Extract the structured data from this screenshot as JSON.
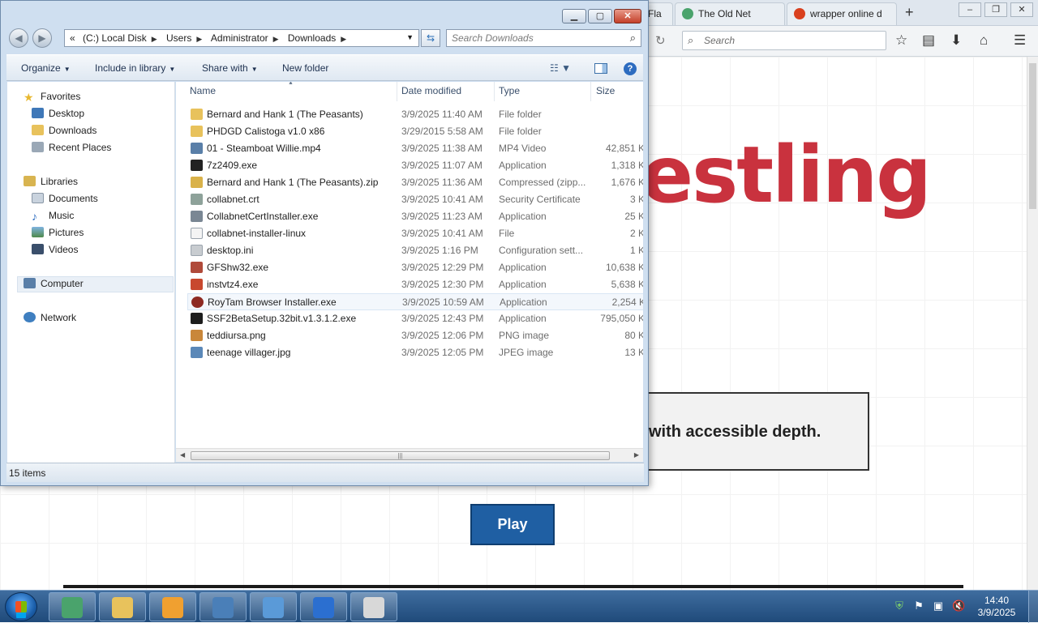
{
  "browser": {
    "tabs": [
      {
        "label": "Fla",
        "icon_color": "#9aa6b2"
      },
      {
        "label": "The Old Net",
        "icon_color": "#4aa36c"
      },
      {
        "label": "wrapper online d",
        "icon_color": "#d9401e"
      }
    ],
    "new_tab_label": "+",
    "search_placeholder": "Search",
    "page_heading_fragment": "estling",
    "info_text_fragment": "with accessible depth.",
    "play_label": "Play",
    "heading_color": "#c9323e"
  },
  "explorer": {
    "address": {
      "chevron": "«",
      "crumbs": [
        "(C:) Local Disk",
        "Users",
        "Administrator",
        "Downloads"
      ]
    },
    "search_placeholder": "Search Downloads",
    "toolbar": {
      "organize": "Organize",
      "include_in_library": "Include in library",
      "share_with": "Share with",
      "new_folder": "New folder"
    },
    "nav": {
      "favorites": "Favorites",
      "desktop": "Desktop",
      "downloads": "Downloads",
      "recent_places": "Recent Places",
      "libraries": "Libraries",
      "documents": "Documents",
      "music": "Music",
      "pictures": "Pictures",
      "videos": "Videos",
      "computer": "Computer",
      "network": "Network"
    },
    "columns": {
      "name": "Name",
      "date": "Date modified",
      "type": "Type",
      "size": "Size"
    },
    "files": [
      {
        "name": "Bernard and Hank 1 (The Peasants)",
        "date": "3/9/2025 11:40 AM",
        "type": "File folder",
        "size": "",
        "icon": "folder-icon",
        "color": "#e8c25c"
      },
      {
        "name": "PHDGD Calistoga v1.0 x86",
        "date": "3/29/2015 5:58 AM",
        "type": "File folder",
        "size": "",
        "icon": "folder-icon",
        "color": "#e8c25c"
      },
      {
        "name": "01 - Steamboat Willie.mp4",
        "date": "3/9/2025 11:38 AM",
        "type": "MP4 Video",
        "size": "42,851 K",
        "icon": "video-file-icon",
        "color": "#5a7fa8"
      },
      {
        "name": "7z2409.exe",
        "date": "3/9/2025 11:07 AM",
        "type": "Application",
        "size": "1,318 K",
        "icon": "7zip-icon",
        "color": "#222222"
      },
      {
        "name": "Bernard and Hank 1 (The Peasants).zip",
        "date": "3/9/2025 11:36 AM",
        "type": "Compressed (zipp...",
        "size": "1,676 K",
        "icon": "zip-folder-icon",
        "color": "#d9b24a"
      },
      {
        "name": "collabnet.crt",
        "date": "3/9/2025 10:41 AM",
        "type": "Security Certificate",
        "size": "3 K",
        "icon": "certificate-icon",
        "color": "#8ea29a"
      },
      {
        "name": "CollabnetCertInstaller.exe",
        "date": "3/9/2025 11:23 AM",
        "type": "Application",
        "size": "25 K",
        "icon": "installer-icon",
        "color": "#7a8794"
      },
      {
        "name": "collabnet-installer-linux",
        "date": "3/9/2025 10:41 AM",
        "type": "File",
        "size": "2 K",
        "icon": "blank-file-icon",
        "color": "#f4f4f4"
      },
      {
        "name": "desktop.ini",
        "date": "3/9/2025 1:16 PM",
        "type": "Configuration sett...",
        "size": "1 K",
        "icon": "settings-file-icon",
        "color": "#c8ccd0"
      },
      {
        "name": "GFShw32.exe",
        "date": "3/9/2025 12:29 PM",
        "type": "Application",
        "size": "10,638 K",
        "icon": "gfs-app-icon",
        "color": "#b04a3a"
      },
      {
        "name": "instvtz4.exe",
        "date": "3/9/2025 12:30 PM",
        "type": "Application",
        "size": "5,638 K",
        "icon": "setup-icon",
        "color": "#c8482e"
      },
      {
        "name": "RoyTam Browser Installer.exe",
        "date": "3/9/2025 10:59 AM",
        "type": "Application",
        "size": "2,254 K",
        "icon": "roytam-icon",
        "color": "#8e2a22"
      },
      {
        "name": "SSF2BetaSetup.32bit.v1.3.1.2.exe",
        "date": "3/9/2025 12:43 PM",
        "type": "Application",
        "size": "795,050 K",
        "icon": "ssf2-icon",
        "color": "#1d1d1d"
      },
      {
        "name": "teddiursa.png",
        "date": "3/9/2025 12:06 PM",
        "type": "PNG image",
        "size": "80 K",
        "icon": "image-file-icon",
        "color": "#c9873a"
      },
      {
        "name": "teenage villager.jpg",
        "date": "3/9/2025 12:05 PM",
        "type": "JPEG image",
        "size": "13 K",
        "icon": "image-file-icon",
        "color": "#5b88b8"
      }
    ],
    "status": "15 items"
  },
  "taskbar": {
    "clock_time": "14:40",
    "clock_date": "3/9/2025",
    "apps": [
      {
        "icon": "browser-app-icon",
        "color": "#4aa36c"
      },
      {
        "icon": "file-explorer-icon",
        "color": "#e8c25c"
      },
      {
        "icon": "media-player-icon",
        "color": "#f0a030"
      },
      {
        "icon": "image-viewer-icon",
        "color": "#4a7fb8"
      },
      {
        "icon": "control-panel-icon",
        "color": "#5a9ad8"
      },
      {
        "icon": "gfs-taskbar-icon",
        "color": "#2b6fd0"
      },
      {
        "icon": "ssf2-taskbar-icon",
        "color": "#d8d8d8"
      }
    ]
  }
}
